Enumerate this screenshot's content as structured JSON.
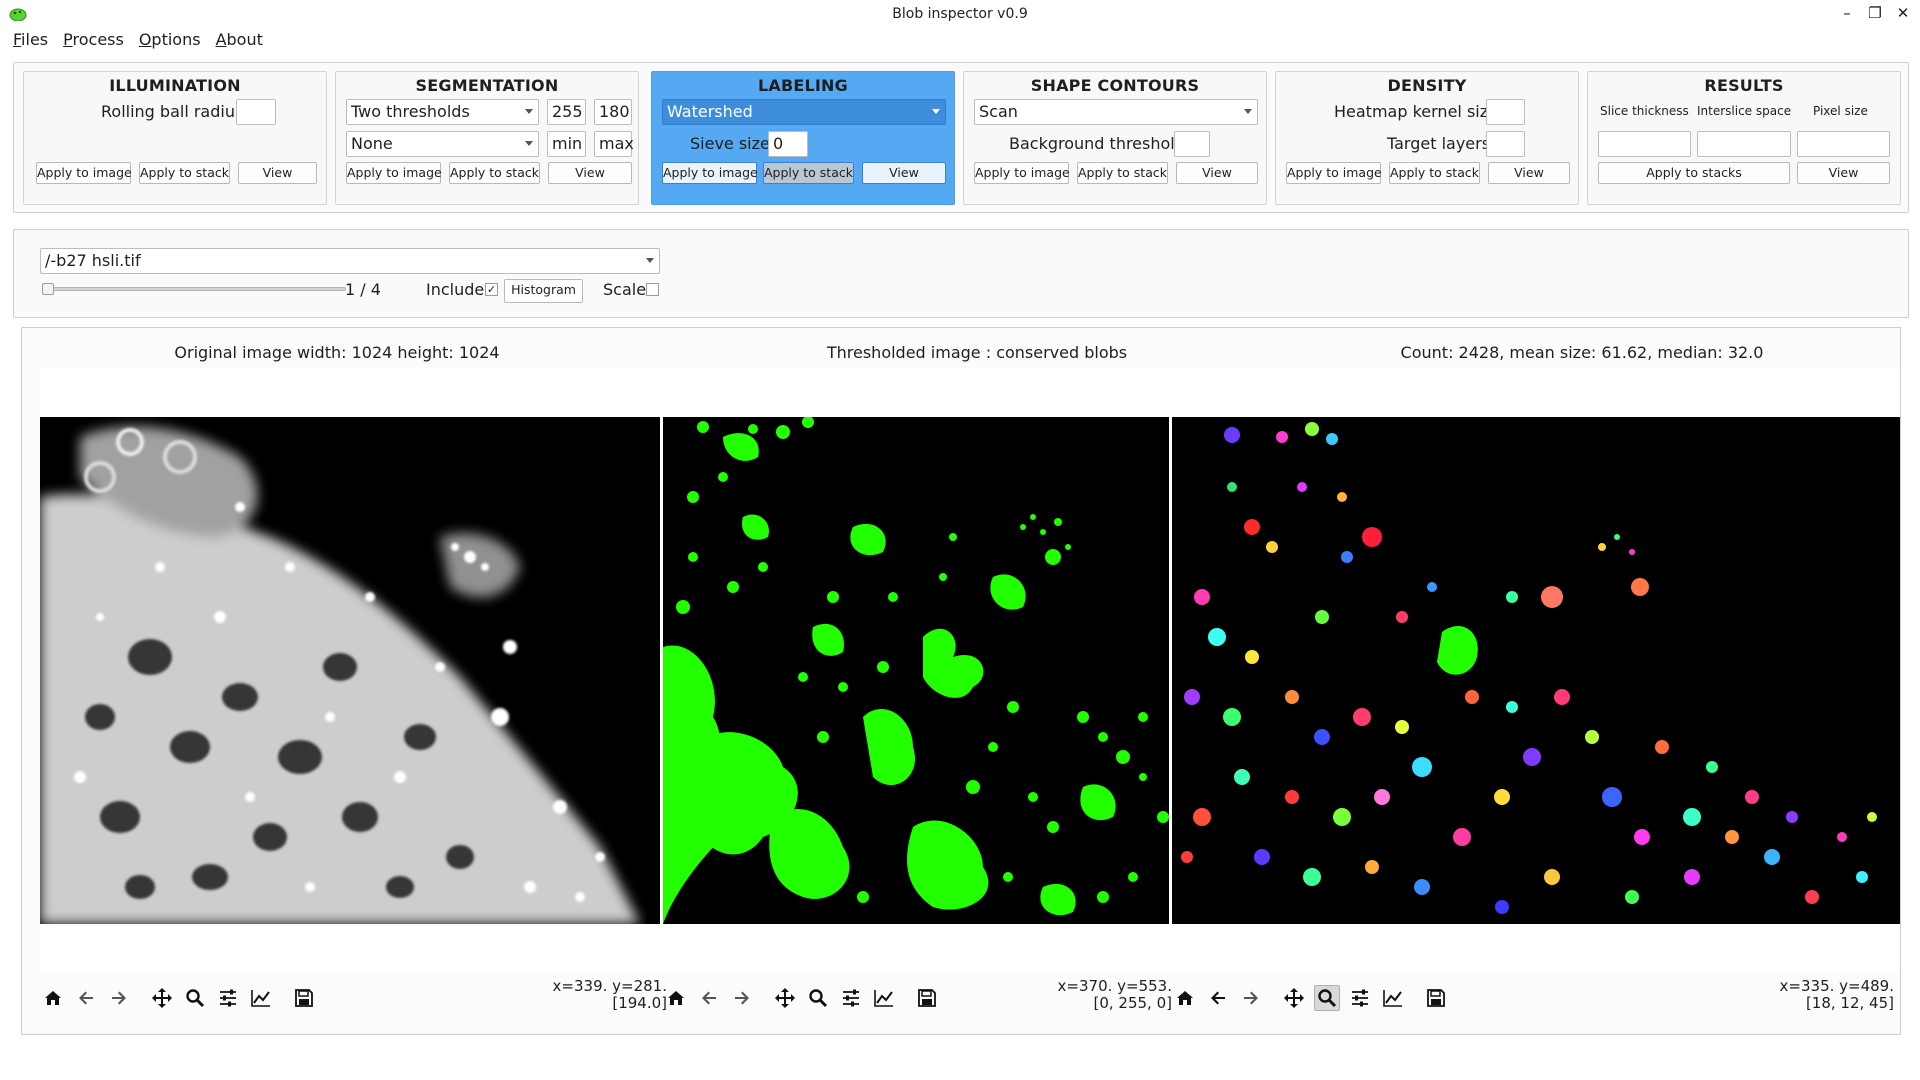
{
  "window": {
    "title": "Blob inspector v0.9",
    "controls": [
      "minimize-icon",
      "maximize-icon",
      "close-icon"
    ]
  },
  "menu": [
    {
      "first": "F",
      "rest": "iles"
    },
    {
      "first": "P",
      "rest": "rocess"
    },
    {
      "first": "O",
      "rest": "ptions"
    },
    {
      "first": "A",
      "rest": "bout"
    }
  ],
  "illumination": {
    "title": "ILLUMINATION",
    "radius_label": "Rolling ball radius",
    "radius_value": "",
    "apply_image": "Apply to image",
    "apply_stack": "Apply to stack",
    "view": "View"
  },
  "segmentation": {
    "title": "SEGMENTATION",
    "method": "Two thresholds",
    "threshold_1": "255",
    "threshold_2": "180",
    "secondary": "None",
    "min_placeholder": "min",
    "max_placeholder": "max",
    "apply_image": "Apply to image",
    "apply_stack": "Apply to stack",
    "view": "View"
  },
  "labeling": {
    "title": "LABELING",
    "method": "Watershed",
    "sieve_label": "Sieve size",
    "sieve_value": "0",
    "apply_image": "Apply to image",
    "apply_stack": "Apply to stack",
    "view": "View"
  },
  "shape_contours": {
    "title": "SHAPE CONTOURS",
    "method": "Scan",
    "bg_label": "Background threshold",
    "bg_value": "",
    "apply_image": "Apply to image",
    "apply_stack": "Apply to stack",
    "view": "View"
  },
  "density": {
    "title": "DENSITY",
    "kernel_label": "Heatmap kernel size",
    "kernel_value": "",
    "layers_label": "Target layers",
    "layers_value": "",
    "apply_image": "Apply to image",
    "apply_stack": "Apply to stack",
    "view": "View"
  },
  "results": {
    "title": "RESULTS",
    "slice_label": "Slice thickness",
    "interslice_label": "Interslice space",
    "pixel_label": "Pixel size",
    "slice_value": "",
    "interslice_value": "",
    "pixel_value": "",
    "apply_stacks": "Apply to stacks",
    "view": "View"
  },
  "file": {
    "path": "/-b27 hsli.tif",
    "position": "1 / 4",
    "slider_fraction": 0.0,
    "include_label": "Include",
    "include_checked": true,
    "histogram": "Histogram",
    "scale_label": "Scale",
    "scale_checked": false
  },
  "viewers": [
    {
      "caption": "Original image width: 1024 height: 1024",
      "coord_line1": "x=339. y=281.",
      "coord_line2": "[194.0]"
    },
    {
      "caption": "Thresholded image : conserved blobs",
      "coord_line1": "x=370. y=553.",
      "coord_line2": "[0, 255, 0]"
    },
    {
      "caption": "Count: 2428, mean size: 61.62, median: 32.0",
      "coord_line1": "x=335. y=489.",
      "coord_line2": "[18, 12, 45]"
    }
  ],
  "toolbar_icons": [
    "home-icon",
    "back-icon",
    "forward-icon",
    "pan-icon",
    "zoom-icon",
    "configure-icon",
    "axes-icon",
    "save-icon"
  ],
  "colors": {
    "active_panel": "#55a8f2",
    "blob_green": "#22ff00",
    "selection_blue": "#3e8ddb"
  }
}
